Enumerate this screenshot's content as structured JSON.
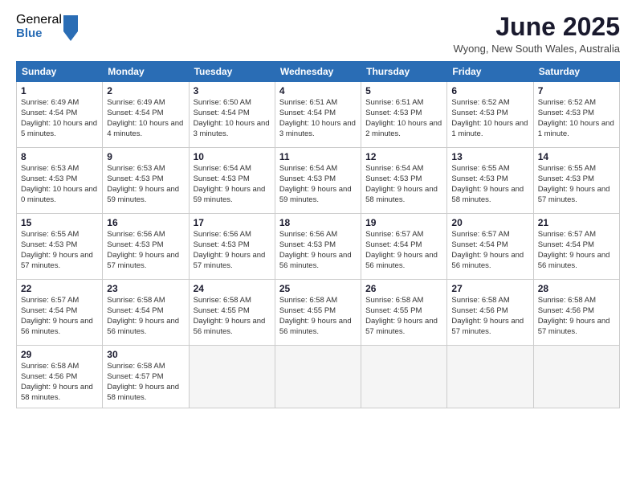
{
  "logo": {
    "general": "General",
    "blue": "Blue"
  },
  "header": {
    "month": "June 2025",
    "location": "Wyong, New South Wales, Australia"
  },
  "weekdays": [
    "Sunday",
    "Monday",
    "Tuesday",
    "Wednesday",
    "Thursday",
    "Friday",
    "Saturday"
  ],
  "weeks": [
    [
      {
        "day": "1",
        "sunrise": "6:49 AM",
        "sunset": "4:54 PM",
        "daylight": "10 hours and 5 minutes."
      },
      {
        "day": "2",
        "sunrise": "6:49 AM",
        "sunset": "4:54 PM",
        "daylight": "10 hours and 4 minutes."
      },
      {
        "day": "3",
        "sunrise": "6:50 AM",
        "sunset": "4:54 PM",
        "daylight": "10 hours and 3 minutes."
      },
      {
        "day": "4",
        "sunrise": "6:51 AM",
        "sunset": "4:54 PM",
        "daylight": "10 hours and 3 minutes."
      },
      {
        "day": "5",
        "sunrise": "6:51 AM",
        "sunset": "4:53 PM",
        "daylight": "10 hours and 2 minutes."
      },
      {
        "day": "6",
        "sunrise": "6:52 AM",
        "sunset": "4:53 PM",
        "daylight": "10 hours and 1 minute."
      },
      {
        "day": "7",
        "sunrise": "6:52 AM",
        "sunset": "4:53 PM",
        "daylight": "10 hours and 1 minute."
      }
    ],
    [
      {
        "day": "8",
        "sunrise": "6:53 AM",
        "sunset": "4:53 PM",
        "daylight": "10 hours and 0 minutes."
      },
      {
        "day": "9",
        "sunrise": "6:53 AM",
        "sunset": "4:53 PM",
        "daylight": "9 hours and 59 minutes."
      },
      {
        "day": "10",
        "sunrise": "6:54 AM",
        "sunset": "4:53 PM",
        "daylight": "9 hours and 59 minutes."
      },
      {
        "day": "11",
        "sunrise": "6:54 AM",
        "sunset": "4:53 PM",
        "daylight": "9 hours and 59 minutes."
      },
      {
        "day": "12",
        "sunrise": "6:54 AM",
        "sunset": "4:53 PM",
        "daylight": "9 hours and 58 minutes."
      },
      {
        "day": "13",
        "sunrise": "6:55 AM",
        "sunset": "4:53 PM",
        "daylight": "9 hours and 58 minutes."
      },
      {
        "day": "14",
        "sunrise": "6:55 AM",
        "sunset": "4:53 PM",
        "daylight": "9 hours and 57 minutes."
      }
    ],
    [
      {
        "day": "15",
        "sunrise": "6:55 AM",
        "sunset": "4:53 PM",
        "daylight": "9 hours and 57 minutes."
      },
      {
        "day": "16",
        "sunrise": "6:56 AM",
        "sunset": "4:53 PM",
        "daylight": "9 hours and 57 minutes."
      },
      {
        "day": "17",
        "sunrise": "6:56 AM",
        "sunset": "4:53 PM",
        "daylight": "9 hours and 57 minutes."
      },
      {
        "day": "18",
        "sunrise": "6:56 AM",
        "sunset": "4:53 PM",
        "daylight": "9 hours and 56 minutes."
      },
      {
        "day": "19",
        "sunrise": "6:57 AM",
        "sunset": "4:54 PM",
        "daylight": "9 hours and 56 minutes."
      },
      {
        "day": "20",
        "sunrise": "6:57 AM",
        "sunset": "4:54 PM",
        "daylight": "9 hours and 56 minutes."
      },
      {
        "day": "21",
        "sunrise": "6:57 AM",
        "sunset": "4:54 PM",
        "daylight": "9 hours and 56 minutes."
      }
    ],
    [
      {
        "day": "22",
        "sunrise": "6:57 AM",
        "sunset": "4:54 PM",
        "daylight": "9 hours and 56 minutes."
      },
      {
        "day": "23",
        "sunrise": "6:58 AM",
        "sunset": "4:54 PM",
        "daylight": "9 hours and 56 minutes."
      },
      {
        "day": "24",
        "sunrise": "6:58 AM",
        "sunset": "4:55 PM",
        "daylight": "9 hours and 56 minutes."
      },
      {
        "day": "25",
        "sunrise": "6:58 AM",
        "sunset": "4:55 PM",
        "daylight": "9 hours and 56 minutes."
      },
      {
        "day": "26",
        "sunrise": "6:58 AM",
        "sunset": "4:55 PM",
        "daylight": "9 hours and 57 minutes."
      },
      {
        "day": "27",
        "sunrise": "6:58 AM",
        "sunset": "4:56 PM",
        "daylight": "9 hours and 57 minutes."
      },
      {
        "day": "28",
        "sunrise": "6:58 AM",
        "sunset": "4:56 PM",
        "daylight": "9 hours and 57 minutes."
      }
    ],
    [
      {
        "day": "29",
        "sunrise": "6:58 AM",
        "sunset": "4:56 PM",
        "daylight": "9 hours and 58 minutes."
      },
      {
        "day": "30",
        "sunrise": "6:58 AM",
        "sunset": "4:57 PM",
        "daylight": "9 hours and 58 minutes."
      },
      null,
      null,
      null,
      null,
      null
    ]
  ]
}
